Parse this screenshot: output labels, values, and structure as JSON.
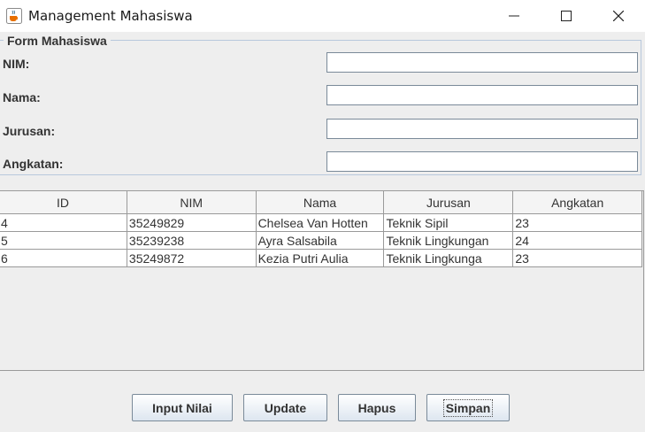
{
  "window": {
    "title": "Management Mahasiswa",
    "icon": "java-cup-icon"
  },
  "form": {
    "legend": "Form Mahasiswa",
    "fields": [
      {
        "label": "NIM:",
        "value": ""
      },
      {
        "label": "Nama:",
        "value": ""
      },
      {
        "label": "Jurusan:",
        "value": ""
      },
      {
        "label": "Angkatan:",
        "value": ""
      }
    ]
  },
  "table": {
    "columns": [
      "ID",
      "NIM",
      "Nama",
      "Jurusan",
      "Angkatan"
    ],
    "rows": [
      [
        "4",
        "35249829",
        "Chelsea Van Hotten",
        "Teknik Sipil",
        "23"
      ],
      [
        "5",
        "35239238",
        "Ayra Salsabila",
        "Teknik Lingkungan",
        "24"
      ],
      [
        "6",
        "35249872",
        "Kezia Putri Aulia",
        "Teknik Lingkunga",
        "23"
      ]
    ]
  },
  "buttons": {
    "input_nilai": "Input Nilai",
    "update": "Update",
    "hapus": "Hapus",
    "simpan": "Simpan"
  }
}
